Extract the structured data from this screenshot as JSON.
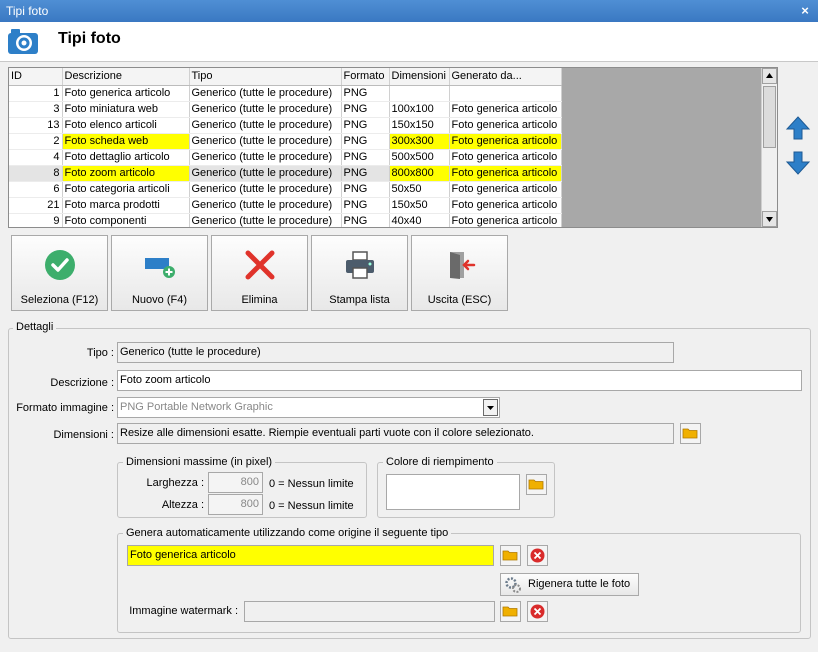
{
  "window": {
    "title": "Tipi foto",
    "close": "×"
  },
  "header": {
    "title": "Tipi foto"
  },
  "grid": {
    "columns": [
      "ID",
      "Descrizione",
      "Tipo",
      "Formato",
      "Dimensioni",
      "Generato da..."
    ],
    "rows": [
      {
        "id": "1",
        "descrizione": "Foto generica articolo",
        "tipo": "Generico (tutte le procedure)",
        "formato": "PNG",
        "dimensioni": "",
        "generato": ""
      },
      {
        "id": "3",
        "descrizione": "Foto miniatura web",
        "tipo": "Generico (tutte le procedure)",
        "formato": "PNG",
        "dimensioni": "100x100",
        "generato": "Foto generica articolo"
      },
      {
        "id": "13",
        "descrizione": "Foto elenco articoli",
        "tipo": "Generico (tutte le procedure)",
        "formato": "PNG",
        "dimensioni": "150x150",
        "generato": "Foto generica articolo"
      },
      {
        "id": "2",
        "descrizione": "Foto scheda web",
        "tipo": "Generico (tutte le procedure)",
        "formato": "PNG",
        "dimensioni": "300x300",
        "generato": "Foto generica articolo"
      },
      {
        "id": "4",
        "descrizione": "Foto dettaglio articolo",
        "tipo": "Generico (tutte le procedure)",
        "formato": "PNG",
        "dimensioni": "500x500",
        "generato": "Foto generica articolo"
      },
      {
        "id": "8",
        "descrizione": "Foto zoom articolo",
        "tipo": "Generico (tutte le procedure)",
        "formato": "PNG",
        "dimensioni": "800x800",
        "generato": "Foto generica articolo"
      },
      {
        "id": "6",
        "descrizione": "Foto categoria articoli",
        "tipo": "Generico (tutte le procedure)",
        "formato": "PNG",
        "dimensioni": "50x50",
        "generato": "Foto generica articolo"
      },
      {
        "id": "21",
        "descrizione": "Foto marca prodotti",
        "tipo": "Generico (tutte le procedure)",
        "formato": "PNG",
        "dimensioni": "150x50",
        "generato": "Foto generica articolo"
      },
      {
        "id": "9",
        "descrizione": "Foto componenti",
        "tipo": "Generico (tutte le procedure)",
        "formato": "PNG",
        "dimensioni": "40x40",
        "generato": "Foto generica articolo"
      }
    ]
  },
  "toolbar": {
    "select_label": "Seleziona (F12)",
    "new_label": "Nuovo (F4)",
    "delete_label": "Elimina",
    "print_label": "Stampa lista",
    "exit_label": "Uscita (ESC)"
  },
  "details": {
    "legend": "Dettagli",
    "tipo_label": "Tipo :",
    "tipo_value": "Generico (tutte le procedure)",
    "descrizione_label": "Descrizione :",
    "descrizione_value": "Foto zoom articolo",
    "formato_label": "Formato immagine :",
    "formato_value": "PNG Portable Network Graphic",
    "dimensioni_label": "Dimensioni :",
    "dimensioni_value": "Resize alle dimensioni esatte. Riempie eventuali parti vuote con il colore selezionato.",
    "maxdim": {
      "legend": "Dimensioni massime (in pixel)",
      "width_label": "Larghezza :",
      "width_value": "800",
      "height_label": "Altezza :",
      "height_value": "800",
      "hint": "0 = Nessun limite"
    },
    "fill": {
      "legend": "Colore di riempimento"
    },
    "auto": {
      "legend": "Genera automaticamente utilizzando come origine il seguente tipo",
      "source_value": "Foto generica articolo",
      "regen_label": "Rigenera tutte le foto",
      "watermark_label": "Immagine watermark :",
      "watermark_value": ""
    }
  },
  "colors": {
    "highlight": "#ffff00",
    "accent": "#3a78c2"
  }
}
